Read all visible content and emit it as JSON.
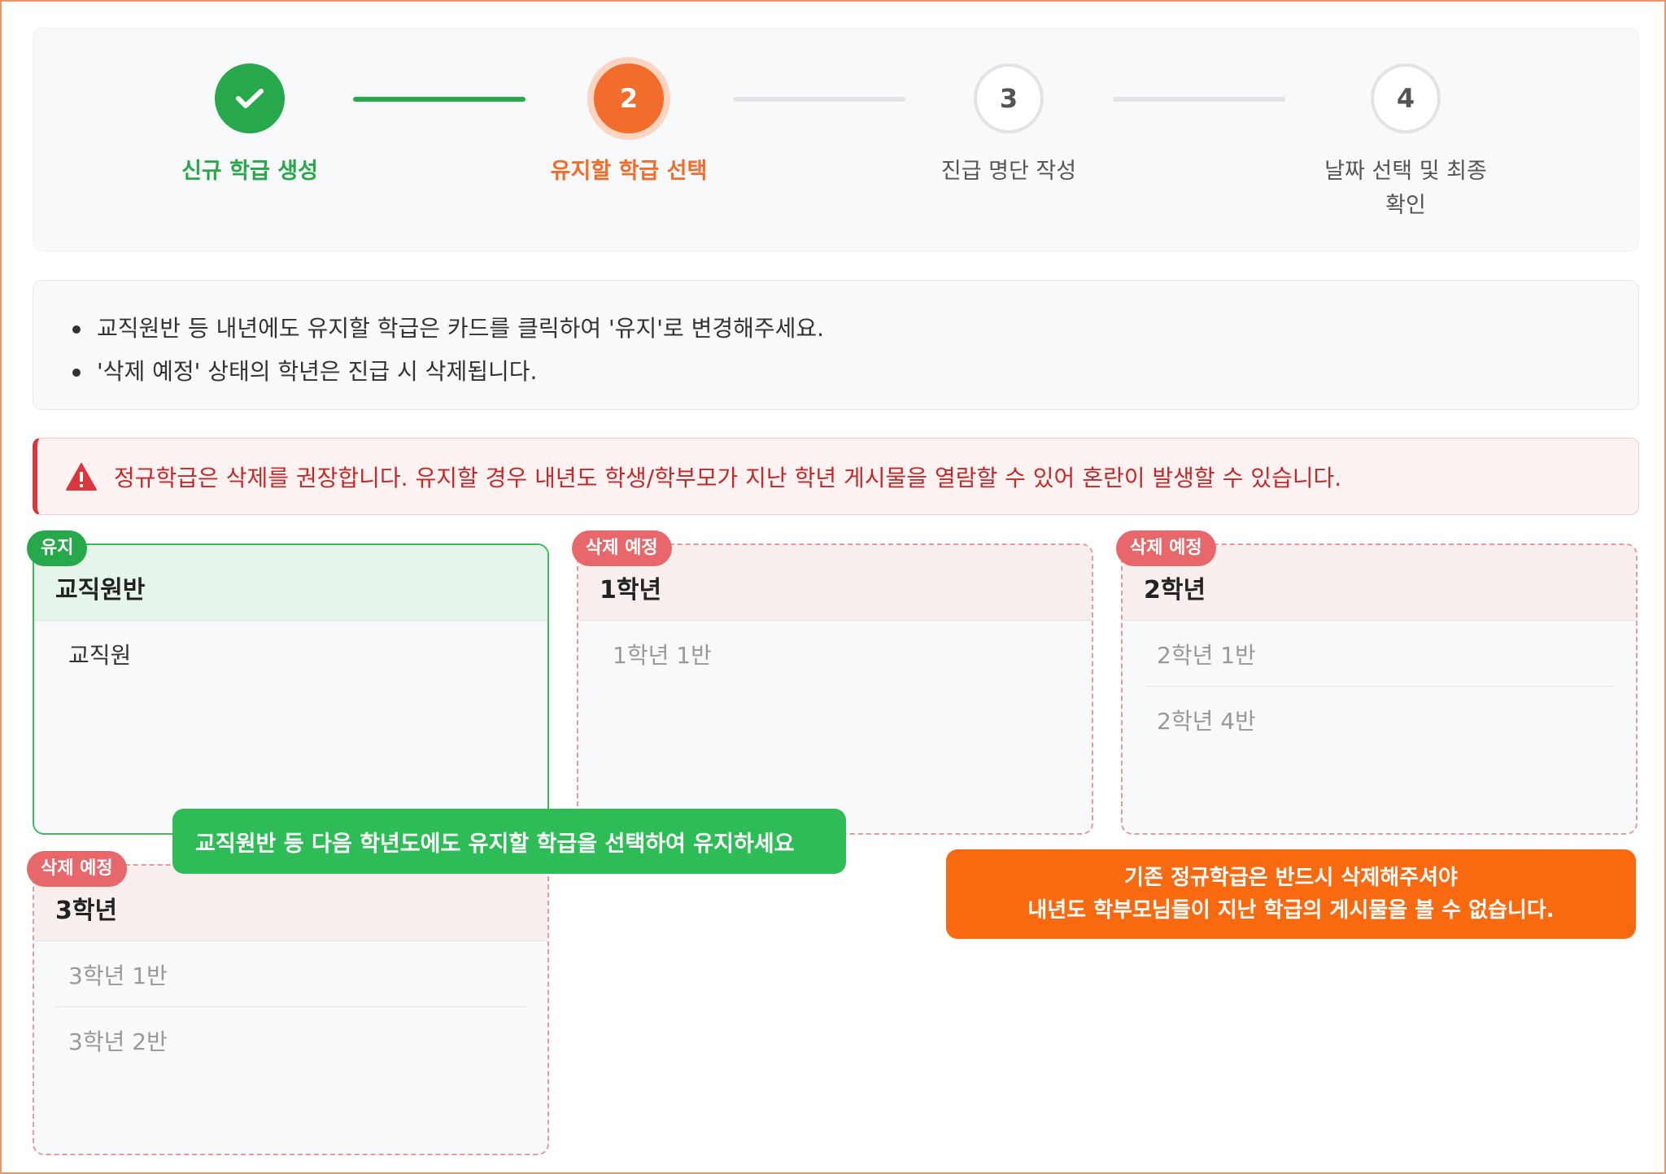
{
  "stepper": {
    "steps": [
      {
        "number": "",
        "label": "신규 학급 생성",
        "state": "done",
        "icon": "check-icon"
      },
      {
        "number": "2",
        "label": "유지할 학급 선택",
        "state": "active"
      },
      {
        "number": "3",
        "label": "진급 명단 작성",
        "state": "pending"
      },
      {
        "number": "4",
        "label_line1": "날짜 선택 및 최종",
        "label_line2": "확인",
        "state": "pending"
      }
    ]
  },
  "info": {
    "items": [
      "교직원반 등 내년에도 유지할 학급은 카드를 클릭하여 '유지'로 변경해주세요.",
      "'삭제 예정' 상태의 학년은 진급 시 삭제됩니다."
    ]
  },
  "alert": {
    "icon": "warning-icon",
    "text": "정규학급은 삭제를 권장합니다. 유지할 경우 내년도 학생/학부모가 지난 학년 게시물을 열람할 수 있어 혼란이 발생할 수 있습니다."
  },
  "cards": [
    {
      "badge": "유지",
      "title": "교직원반",
      "status": "keep",
      "items": [
        "교직원"
      ]
    },
    {
      "badge": "삭제 예정",
      "title": "1학년",
      "status": "delete",
      "items": [
        "1학년 1반"
      ]
    },
    {
      "badge": "삭제 예정",
      "title": "2학년",
      "status": "delete",
      "items": [
        "2학년 1반",
        "2학년 4반"
      ]
    },
    {
      "badge": "삭제 예정",
      "title": "3학년",
      "status": "delete",
      "items": [
        "3학년 1반",
        "3학년 2반"
      ]
    }
  ],
  "tooltips": {
    "green": "교직원반 등 다음 학년도에도 유지할 학급을 선택하여 유지하세요",
    "orange_line1": "기존 정규학급은 반드시 삭제해주셔야",
    "orange_line2": "내년도 학부모님들이 지난 학급의 게시물을 볼 수 없습니다."
  },
  "colors": {
    "done": "#27a84a",
    "active": "#f26d2b",
    "pending": "#e1e3e6",
    "alert": "#d9363e",
    "tip_green": "#2dbc55",
    "tip_orange": "#f96a10"
  }
}
